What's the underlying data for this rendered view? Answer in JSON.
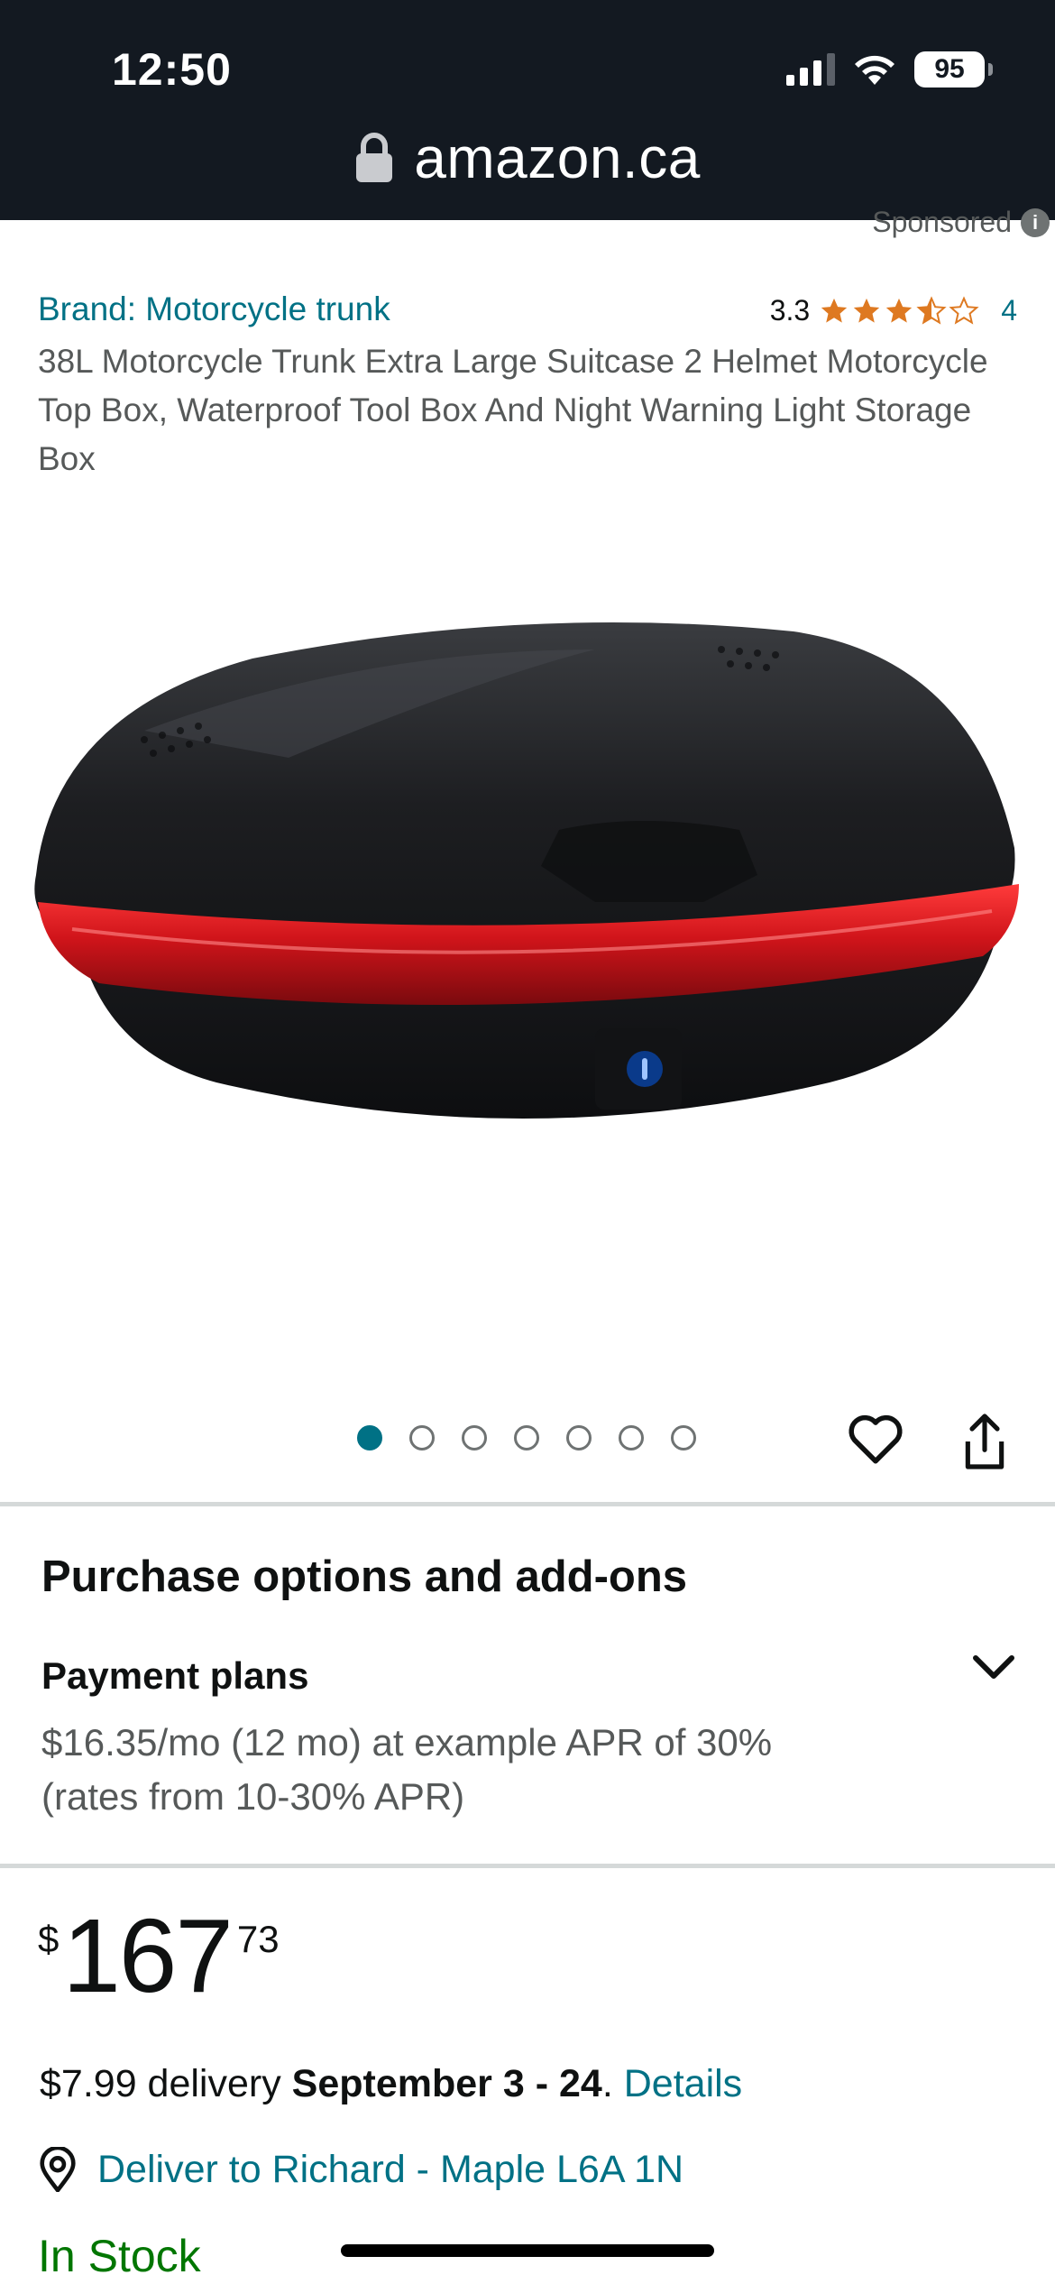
{
  "status_bar": {
    "time": "12:50",
    "battery": "95"
  },
  "url_bar": {
    "domain": "amazon.ca"
  },
  "sponsored": {
    "label": "Sponsored",
    "icon": "info-icon"
  },
  "product": {
    "brand": "Brand: Motorcycle trunk",
    "rating": "3.3",
    "rating_stars": 3.5,
    "review_count": "4",
    "title": "38L Motorcycle Trunk Extra Large Suitcase 2 Helmet Motorcycle Top Box, Waterproof Tool Box And Night Warning Light Storage Box",
    "image_count": 7,
    "active_image": 1
  },
  "purchase_options": {
    "heading": "Purchase options and add-ons",
    "payment_plans_label": "Payment plans",
    "payment_plans_desc": "$16.35/mo (12 mo) at example APR of 30% (rates from 10-30% APR)"
  },
  "price": {
    "symbol": "$",
    "whole": "167",
    "fraction": "73"
  },
  "delivery": {
    "cost": "$7.99 delivery ",
    "dates": "September 3 - 24",
    "period": ". ",
    "details_link": "Details"
  },
  "deliver_to": {
    "label": "Deliver to Richard - Maple L6A 1N"
  },
  "stock": {
    "status": "In Stock"
  },
  "colors": {
    "top_bar": "#131921",
    "link": "#007185",
    "star": "#de7921",
    "in_stock": "#007600"
  }
}
